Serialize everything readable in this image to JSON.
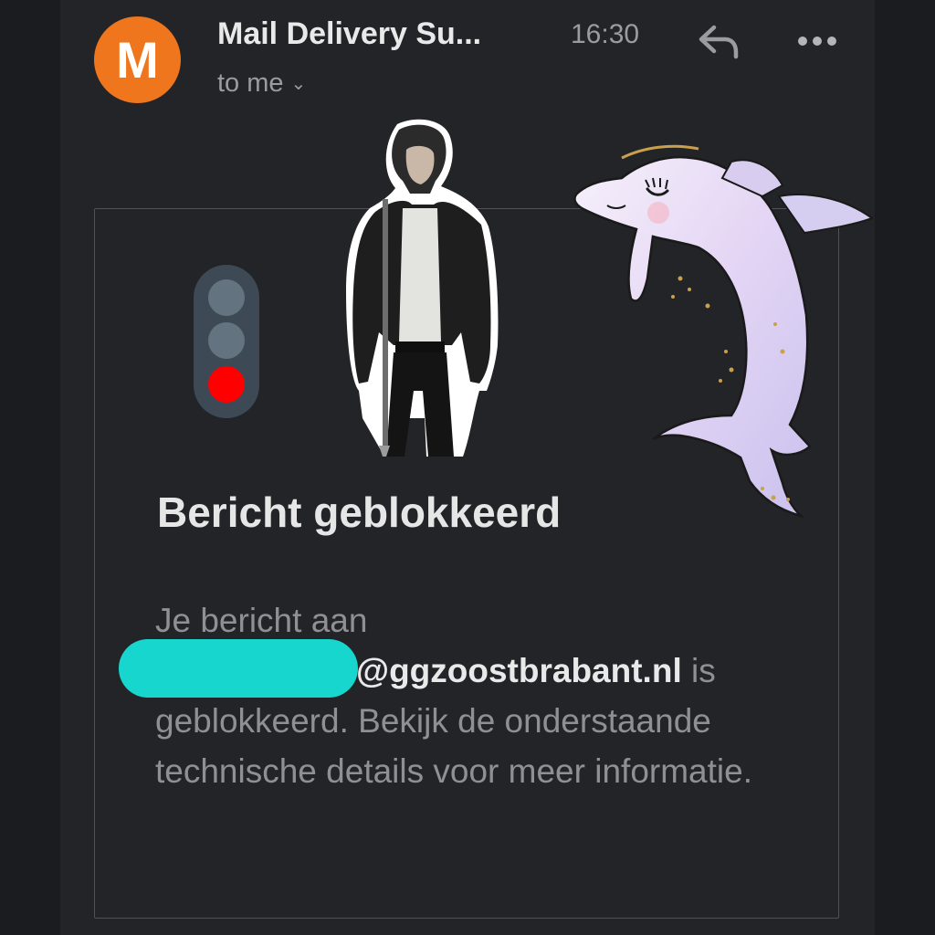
{
  "header": {
    "avatar_letter": "M",
    "sender": "Mail Delivery Su...",
    "time": "16:30",
    "recipient": "to me",
    "reply_icon": "reply-icon",
    "more_icon": "more-horizontal-icon"
  },
  "message": {
    "status_icon": "traffic-light-red-icon",
    "title": "Bericht geblokkeerd",
    "body_prefix": "Je bericht aan",
    "recipient_domain": "@ggzoostbrabant.nl",
    "body_suffix": " is geblokkeerd. Bekijk de onderstaande technische details voor meer informatie."
  },
  "colors": {
    "avatar": "#f0761e",
    "background": "#232427",
    "redaction": "#17d6cd",
    "red_light": "#ff0000"
  }
}
